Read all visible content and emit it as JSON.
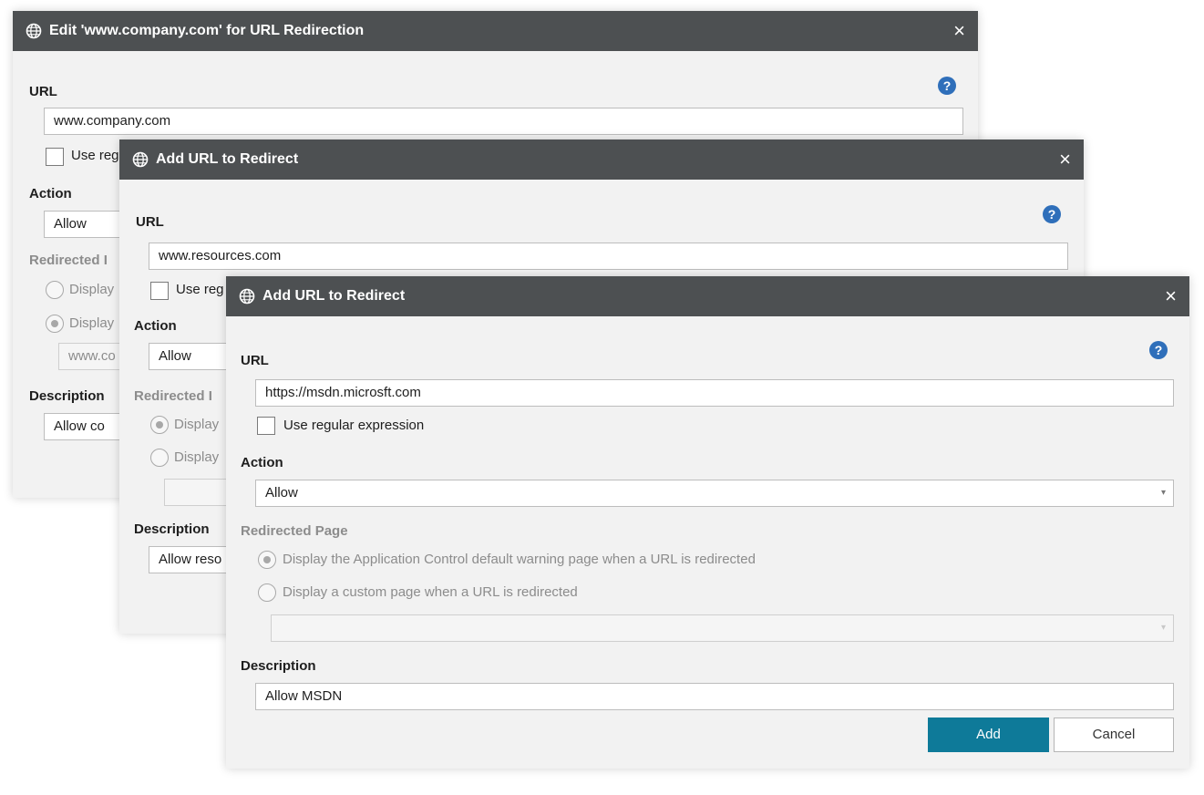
{
  "dialog1": {
    "title": "Edit 'www.company.com' for URL Redirection",
    "url_label": "URL",
    "url_value": "www.company.com",
    "regex_label": "Use reg",
    "action_label": "Action",
    "action_value": "Allow",
    "redirected_label": "Redirected I",
    "radio1": "Display",
    "radio2": "Display",
    "custom_value": "www.co",
    "description_label": "Description",
    "description_value": "Allow co"
  },
  "dialog2": {
    "title": "Add URL to Redirect",
    "url_label": "URL",
    "url_value": "www.resources.com",
    "regex_label": "Use reg",
    "action_label": "Action",
    "action_value": "Allow",
    "redirected_label": "Redirected I",
    "radio1": "Display",
    "radio2": "Display",
    "description_label": "Description",
    "description_value": "Allow reso"
  },
  "dialog3": {
    "title": "Add URL to Redirect",
    "url_label": "URL",
    "url_value": "https://msdn.microsft.com",
    "regex_label": "Use regular expression",
    "action_label": "Action",
    "action_value": "Allow",
    "redirected_label": "Redirected Page",
    "radio1": "Display the Application Control default warning page when a URL is redirected",
    "radio2": "Display a custom page when a URL is redirected",
    "custom_value": "",
    "description_label": "Description",
    "description_value": "Allow MSDN",
    "add_label": "Add",
    "cancel_label": "Cancel"
  },
  "icons": {
    "globe": "globe-icon",
    "close": "close-icon",
    "help": "help-icon",
    "dropdown": "chevron-down-icon"
  },
  "glyphs": {
    "close": "×",
    "help": "?",
    "caret": "▾"
  },
  "colors": {
    "titlebar": "#4d5052",
    "primary": "#0e7a99",
    "help": "#2f6fba",
    "dialog_bg": "#f2f2f2"
  }
}
